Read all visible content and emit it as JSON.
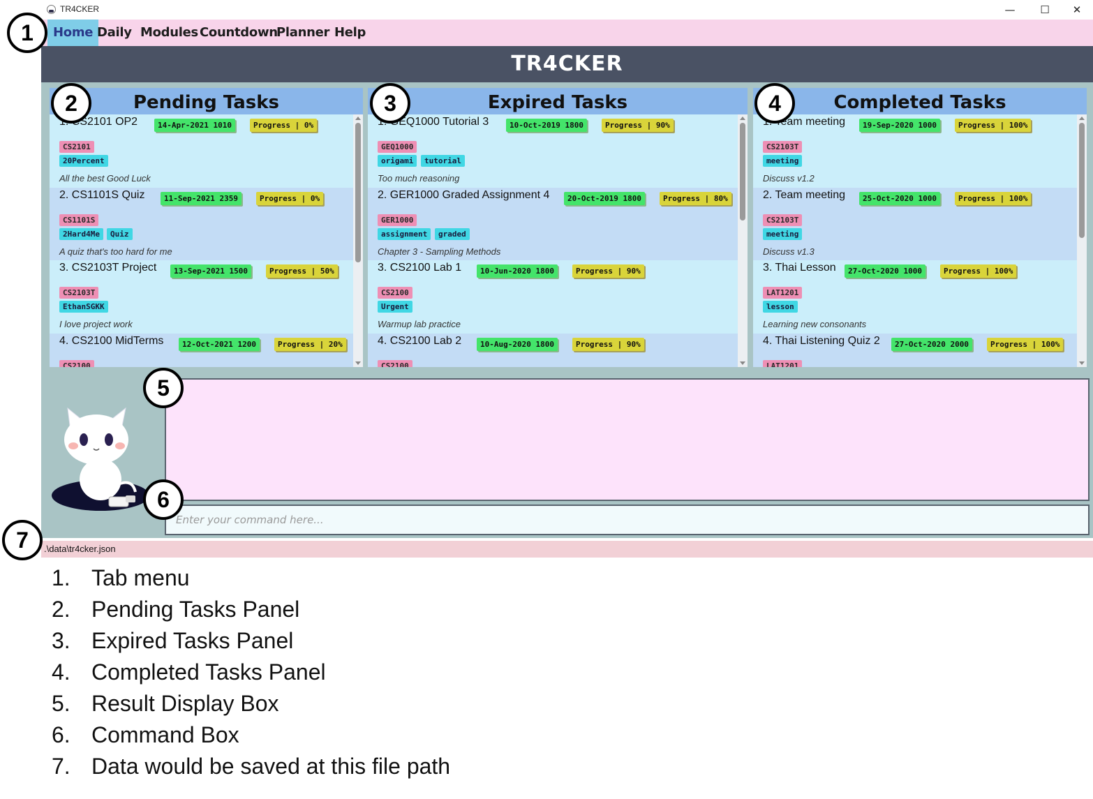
{
  "window": {
    "title": "TR4CKER",
    "controls": [
      "—",
      "☐",
      "✕"
    ]
  },
  "menu": {
    "items": [
      {
        "label": "Home",
        "active": true
      },
      {
        "label": "Daily",
        "active": false
      },
      {
        "label": "Modules",
        "active": false
      },
      {
        "label": "Countdown",
        "active": false
      },
      {
        "label": "Planner",
        "active": false
      },
      {
        "label": "Help",
        "active": false
      }
    ]
  },
  "banner": {
    "title": "TR4CKER"
  },
  "panels": {
    "pending": {
      "title": "Pending Tasks",
      "tasks": [
        {
          "index": "1.",
          "name": "CS2101 OP2",
          "deadline": "14-Apr-2021 1010",
          "progress": "Progress | 0%",
          "module": "CS2101",
          "tags": [
            "20Percent"
          ],
          "description": "All the best Good Luck"
        },
        {
          "index": "2.",
          "name": "CS1101S Quiz",
          "deadline": "11-Sep-2021 2359",
          "progress": "Progress | 0%",
          "module": "CS1101S",
          "tags": [
            "2Hard4Me",
            "Quiz"
          ],
          "description": "A quiz that's too hard for me"
        },
        {
          "index": "3.",
          "name": "CS2103T Project",
          "deadline": "13-Sep-2021 1500",
          "progress": "Progress | 50%",
          "module": "CS2103T",
          "tags": [
            "EthanSGKK"
          ],
          "description": "I love project work"
        },
        {
          "index": "4.",
          "name": "CS2100 MidTerms",
          "deadline": "12-Oct-2021 1200",
          "progress": "Progress | 20%",
          "module": "CS2100",
          "tags": [],
          "description": ""
        }
      ]
    },
    "expired": {
      "title": "Expired Tasks",
      "tasks": [
        {
          "index": "1.",
          "name": "GEQ1000 Tutorial 3",
          "deadline": "10-Oct-2019 1800",
          "progress": "Progress | 90%",
          "module": "GEQ1000",
          "tags": [
            "origami",
            "tutorial"
          ],
          "description": "Too much reasoning"
        },
        {
          "index": "2.",
          "name": "GER1000 Graded Assignment 4",
          "deadline": "20-Oct-2019 1800",
          "progress": "Progress | 80%",
          "module": "GER1000",
          "tags": [
            "assignment",
            "graded"
          ],
          "description": "Chapter 3 - Sampling Methods"
        },
        {
          "index": "3.",
          "name": "CS2100 Lab 1",
          "deadline": "10-Jun-2020 1800",
          "progress": "Progress | 90%",
          "module": "CS2100",
          "tags": [
            "Urgent"
          ],
          "description": "Warmup lab practice"
        },
        {
          "index": "4.",
          "name": "CS2100 Lab 2",
          "deadline": "10-Aug-2020 1800",
          "progress": "Progress | 90%",
          "module": "CS2100",
          "tags": [],
          "description": ""
        }
      ]
    },
    "completed": {
      "title": "Completed Tasks",
      "tasks": [
        {
          "index": "1.",
          "name": "Team meeting",
          "deadline": "19-Sep-2020 1000",
          "progress": "Progress | 100%",
          "module": "CS2103T",
          "tags": [
            "meeting"
          ],
          "description": "Discuss v1.2"
        },
        {
          "index": "2.",
          "name": "Team meeting",
          "deadline": "25-Oct-2020 1000",
          "progress": "Progress | 100%",
          "module": "CS2103T",
          "tags": [
            "meeting"
          ],
          "description": "Discuss v1.3"
        },
        {
          "index": "3.",
          "name": "Thai Lesson",
          "deadline": "27-Oct-2020 1000",
          "progress": "Progress | 100%",
          "module": "LAT1201",
          "tags": [
            "lesson"
          ],
          "description": "Learning new consonants"
        },
        {
          "index": "4.",
          "name": "Thai Listening Quiz 2",
          "deadline": "27-Oct-2020 2000",
          "progress": "Progress | 100%",
          "module": "LAT1201",
          "tags": [],
          "description": ""
        }
      ]
    }
  },
  "result_display": {
    "text": ""
  },
  "command_box": {
    "placeholder": "Enter your command here..."
  },
  "status_bar": {
    "file_path": ".\\data\\tr4cker.json"
  },
  "markers": [
    "1",
    "2",
    "3",
    "4",
    "5",
    "6",
    "7"
  ],
  "legend": [
    {
      "num": "1.",
      "text": "Tab menu"
    },
    {
      "num": "2.",
      "text": "Pending Tasks Panel"
    },
    {
      "num": "3.",
      "text": "Expired Tasks Panel"
    },
    {
      "num": "4.",
      "text": "Completed Tasks Panel"
    },
    {
      "num": "5.",
      "text": "Result Display Box"
    },
    {
      "num": "6.",
      "text": "Command Box"
    },
    {
      "num": "7.",
      "text": "Data would be saved at this file path"
    }
  ],
  "colors": {
    "menu_bg": "#f8d4ea",
    "menu_active": "#7fcde8",
    "banner_bg": "#4a5264",
    "panel_header": "#8ab6ea",
    "card_odd": "#cbeefa",
    "card_even": "#c3dcf5",
    "deadline_tag": "#44e46a",
    "progress_tag": "#d9d43a",
    "module_tag": "#ee8fb4",
    "label_tag": "#40d7e4",
    "result_bg": "#fde3fb",
    "status_bg": "#f2d0d6"
  }
}
